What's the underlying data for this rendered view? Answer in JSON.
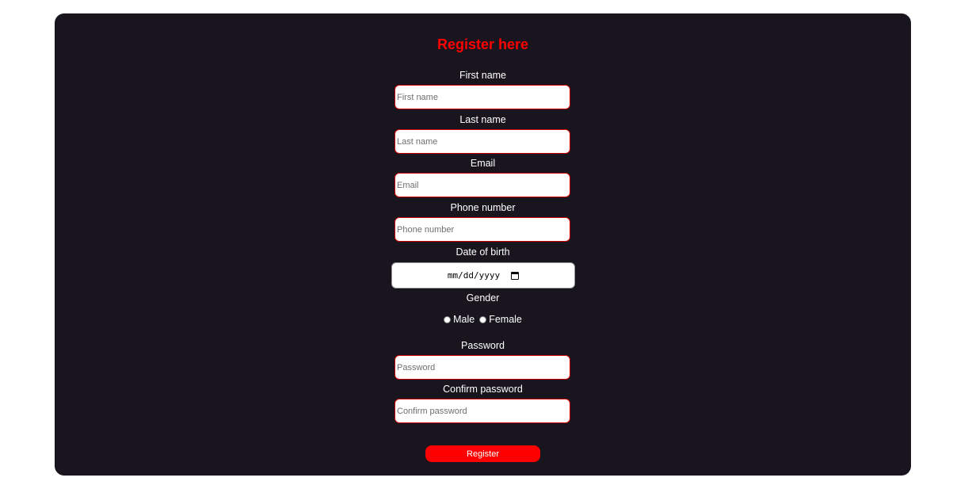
{
  "form": {
    "title": "Register here",
    "first_name": {
      "label": "First name",
      "placeholder": "First name"
    },
    "last_name": {
      "label": "Last name",
      "placeholder": "Last name"
    },
    "email": {
      "label": "Email",
      "placeholder": "Email"
    },
    "phone": {
      "label": "Phone number",
      "placeholder": "Phone number"
    },
    "dob": {
      "label": "Date of birth",
      "value_display": "mm/dd/yyyy",
      "icon": "calendar-icon"
    },
    "gender": {
      "label": "Gender",
      "options": [
        "Male",
        "Female"
      ]
    },
    "password": {
      "label": "Password",
      "placeholder": "Password"
    },
    "confirm_password": {
      "label": "Confirm password",
      "placeholder": "Confirm password"
    },
    "submit_label": "Register"
  },
  "colors": {
    "card_background": "#18151e",
    "accent": "#ff0000",
    "field_border": "#cc0000"
  }
}
